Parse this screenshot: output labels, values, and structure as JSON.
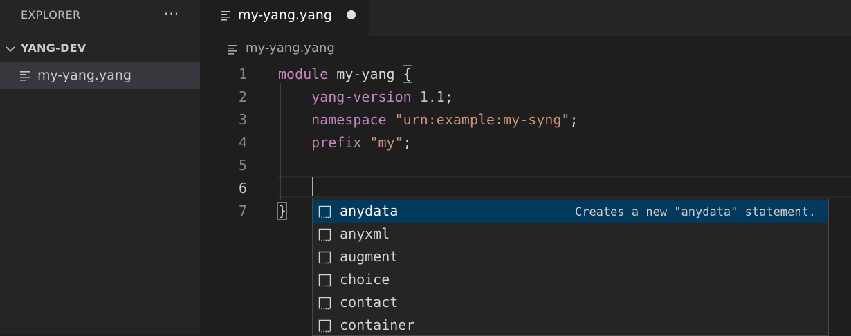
{
  "sidebar": {
    "title": "EXPLORER",
    "more_label": "···",
    "folder": "YANG-DEV",
    "file": "my-yang.yang"
  },
  "tab": {
    "label": "my-yang.yang"
  },
  "breadcrumb": {
    "file": "my-yang.yang"
  },
  "editor": {
    "line_numbers": [
      "1",
      "2",
      "3",
      "4",
      "5",
      "6",
      "7"
    ],
    "lines": {
      "l1_kw": "module",
      "l1_name": " my-yang ",
      "l1_brace": "{",
      "l2_indent": "    ",
      "l2_kw": "yang-version",
      "l2_num": " 1.1",
      "l2_end": ";",
      "l3_indent": "    ",
      "l3_kw": "namespace",
      "l3_str": " \"urn:example:my-syng\"",
      "l3_end": ";",
      "l4_indent": "    ",
      "l4_kw": "prefix",
      "l4_str": " \"my\"",
      "l4_end": ";",
      "l7_brace": "}"
    }
  },
  "suggestions": [
    {
      "label": "anydata",
      "detail": "Creates a new \"anydata\" statement.",
      "selected": true
    },
    {
      "label": "anyxml"
    },
    {
      "label": "augment"
    },
    {
      "label": "choice"
    },
    {
      "label": "contact"
    },
    {
      "label": "container"
    }
  ],
  "colors": {
    "keyword": "#c586c0",
    "string": "#ce9178",
    "number": "#b5cea8",
    "selection": "#04395e"
  }
}
